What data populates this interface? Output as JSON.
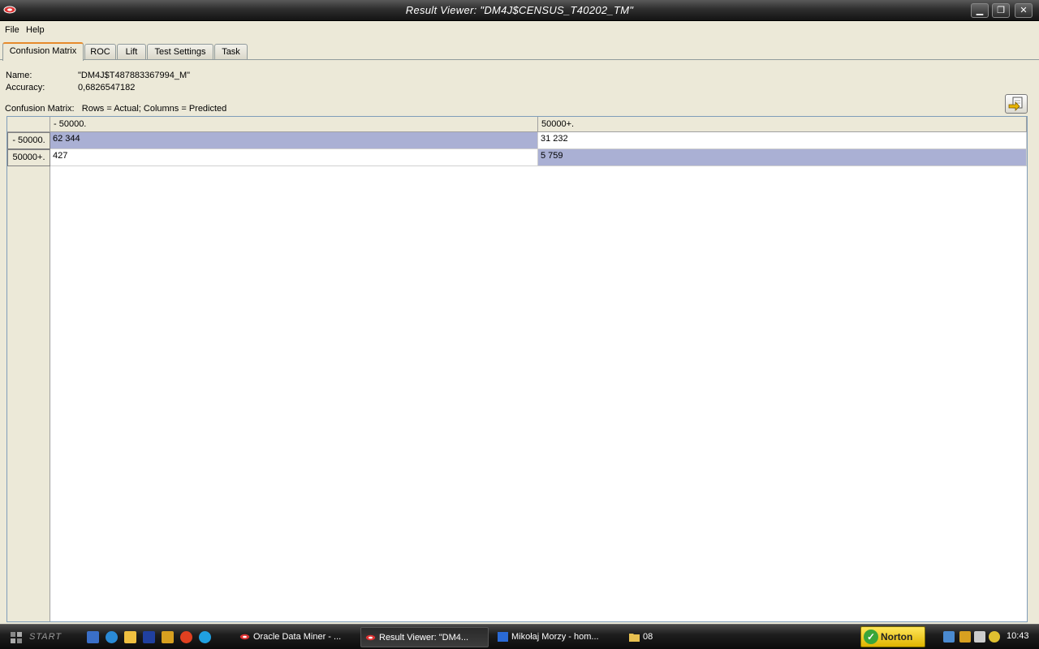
{
  "window": {
    "title": "Result Viewer: \"DM4J$CENSUS_T40202_TM\""
  },
  "window_controls": {
    "minimize": "▁",
    "restore": "❐",
    "close": "✕"
  },
  "menu": {
    "file": "File",
    "help": "Help"
  },
  "tabs": [
    {
      "label": "Confusion Matrix",
      "active": true
    },
    {
      "label": "ROC",
      "active": false
    },
    {
      "label": "Lift",
      "active": false
    },
    {
      "label": "Test Settings",
      "active": false
    },
    {
      "label": "Task",
      "active": false
    }
  ],
  "info": {
    "name_label": "Name:",
    "name_value": "\"DM4J$T487883367994_M\"",
    "accuracy_label": "Accuracy:",
    "accuracy_value": "0,6826547182",
    "matrix_caption": "Confusion Matrix:   Rows = Actual; Columns = Predicted"
  },
  "matrix": {
    "columns": [
      "- 50000.",
      "50000+."
    ],
    "rows": [
      {
        "label": "- 50000.",
        "cells": [
          "62 344",
          "31 232"
        ]
      },
      {
        "label": "50000+.",
        "cells": [
          "427",
          "5 759"
        ]
      }
    ],
    "diagonal_color": "#aab0d4"
  },
  "taskbar": {
    "start_label": "START",
    "tasks": [
      {
        "label": "Oracle Data Miner - ...",
        "active": false
      },
      {
        "label": "Result Viewer: \"DM4...",
        "active": true
      },
      {
        "label": "Mikołaj Morzy - hom...",
        "active": false
      },
      {
        "label": "08",
        "active": false
      }
    ],
    "norton_label": "Norton",
    "clock": "10:43"
  }
}
